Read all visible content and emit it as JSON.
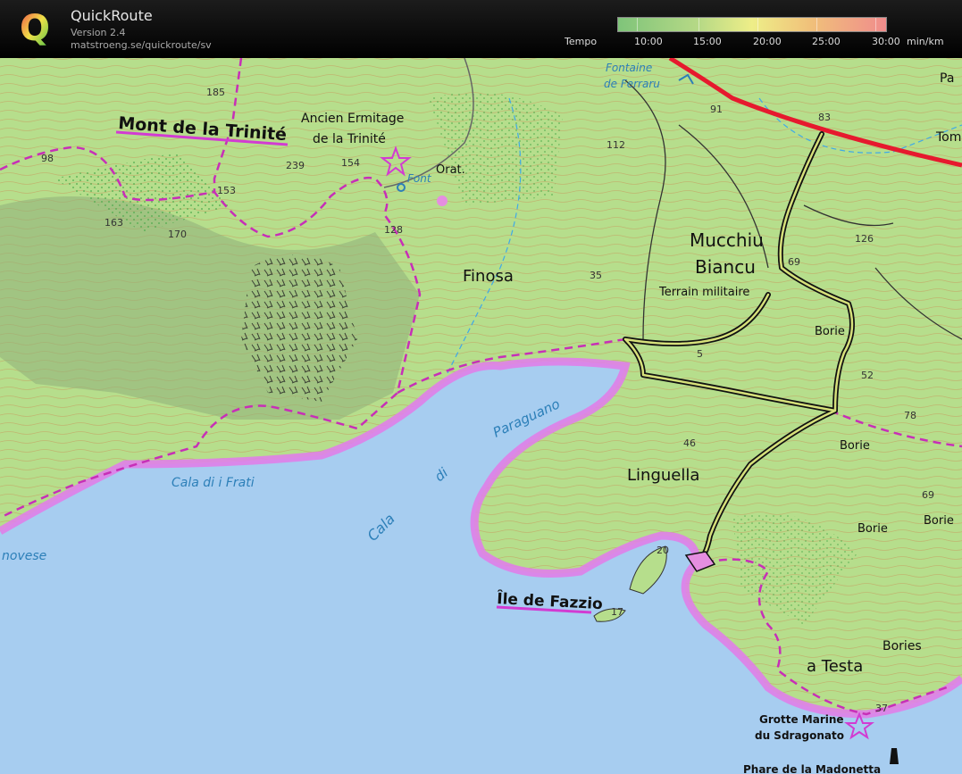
{
  "header": {
    "app_name": "QuickRoute",
    "version": "Version 2.4",
    "url": "matstroeng.se/quickroute/sv",
    "logo_letter": "Q"
  },
  "legend": {
    "label": "Tempo",
    "ticks": [
      "10:00",
      "15:00",
      "20:00",
      "25:00",
      "30:00"
    ],
    "unit": "min/km",
    "colors": {
      "fast": "#7fc47a",
      "mid": "#eeee88",
      "slow": "#f08c8c"
    }
  },
  "map": {
    "places": {
      "mont": "Mont de la Trinité",
      "ermitage_1": "Ancien Ermitage",
      "ermitage_2": "de la Trinité",
      "orat": "Orat.",
      "font": "Font",
      "finosa": "Finosa",
      "mucchiu_1": "Mucchiu",
      "mucchiu_2": "Biancu",
      "terrain": "Terrain militaire",
      "linguella": "Linguella",
      "ile": "Île de Fazzio",
      "testa": "a Testa",
      "grotte_1": "Grotte Marine",
      "grotte_2": "du Sdragonato",
      "phare": "Phare de la Madonetta",
      "pa": "Pa",
      "tom": "Tom",
      "borie1": "Borie",
      "borie2": "Borie",
      "borie3": "Borie",
      "borie4": "Borie",
      "bories": "Bories"
    },
    "water": {
      "fontaine_1": "Fontaine",
      "fontaine_2": "de Ferraru",
      "paraguano": "Paraguano",
      "di": "di",
      "cala": "Cala",
      "frati": "Cala di i Frati",
      "novese": "novese"
    },
    "heights": [
      "185",
      "98",
      "239",
      "154",
      "153",
      "163",
      "170",
      "128",
      "112",
      "91",
      "83",
      "35",
      "69",
      "126",
      "5",
      "52",
      "78",
      "46",
      "69",
      "17",
      "20",
      "37"
    ]
  }
}
